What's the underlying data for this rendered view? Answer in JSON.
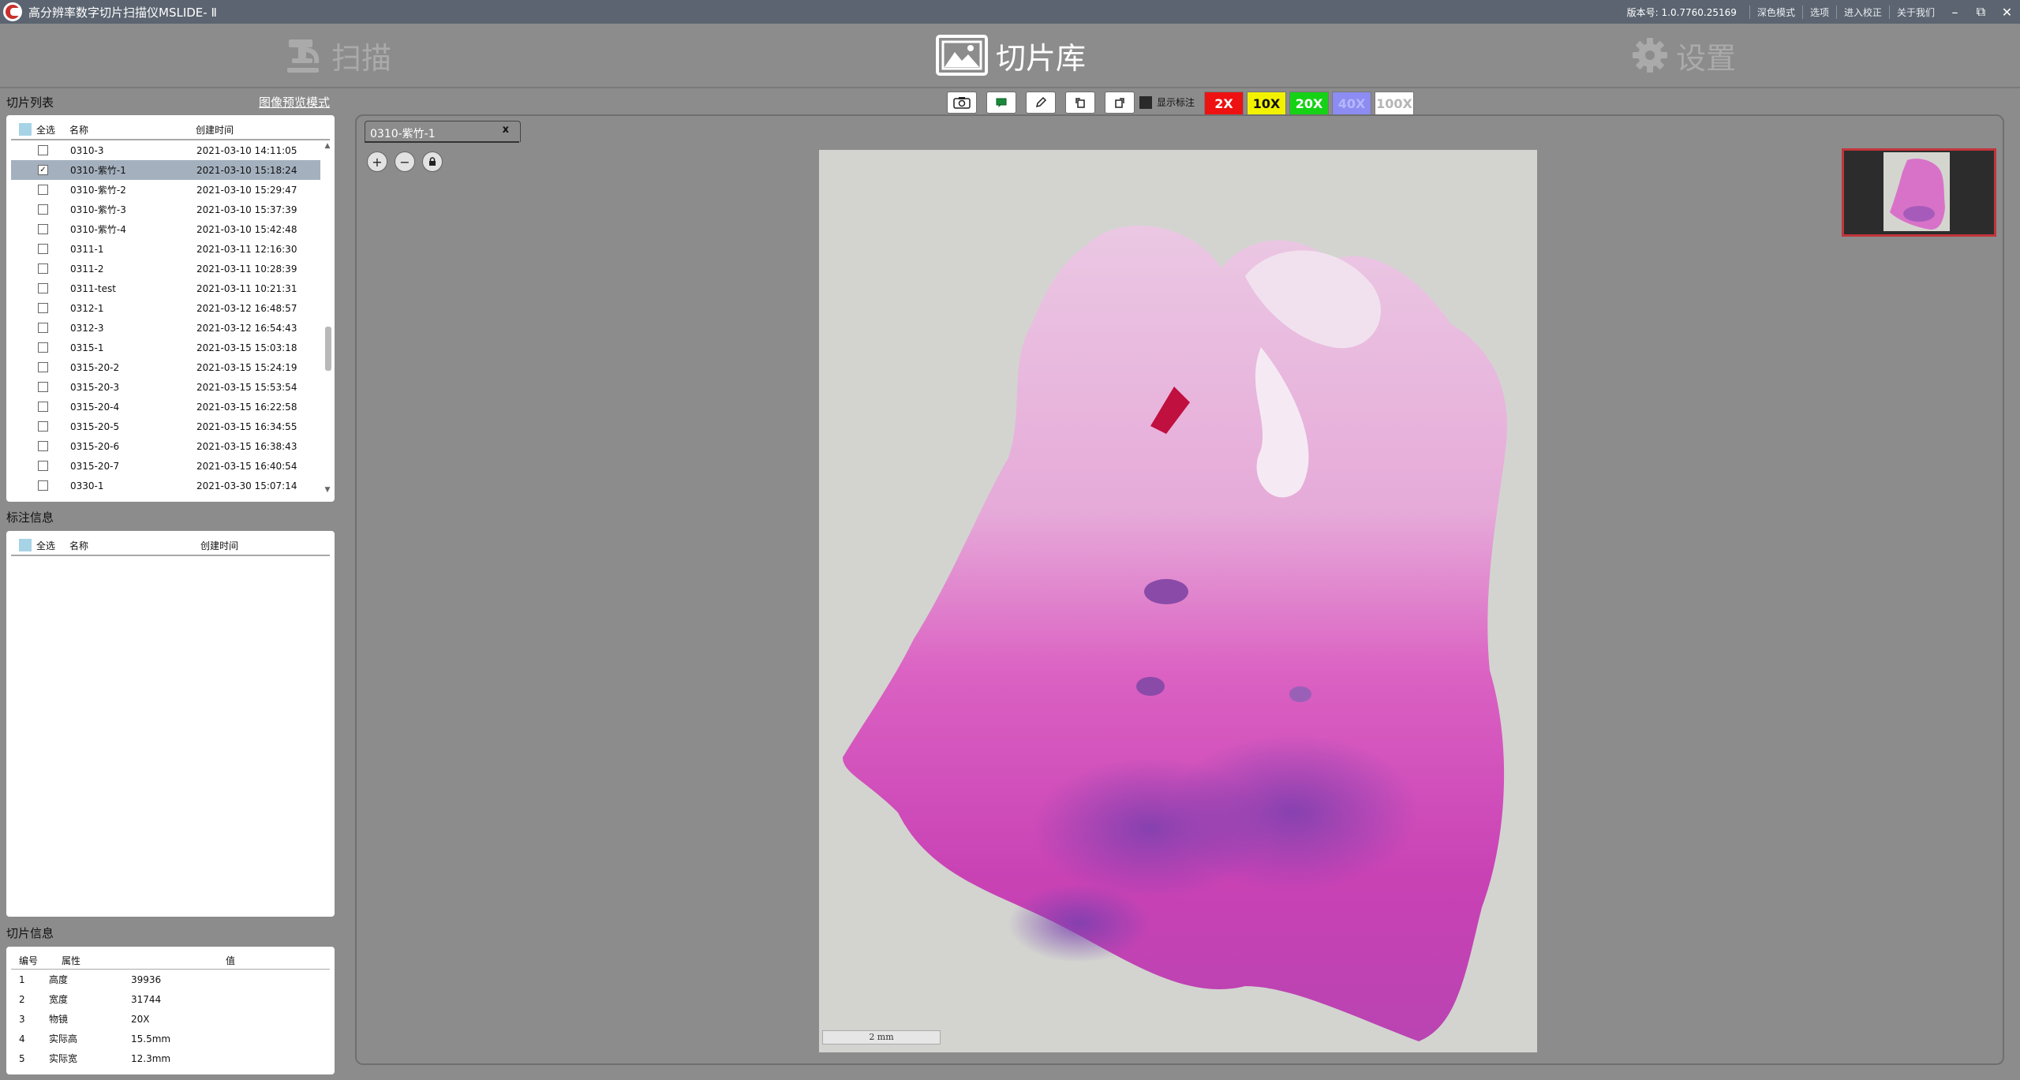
{
  "app": {
    "title": "高分辨率数字切片扫描仪MSLIDE- Ⅱ"
  },
  "titlebar": {
    "version_label": "版本号: 1.0.7760.25169",
    "links": [
      "深色模式",
      "选项",
      "进入校正",
      "关于我们"
    ],
    "window_controls": [
      "minimize-icon",
      "restore-icon",
      "close-icon"
    ]
  },
  "nav": {
    "scan": "扫描",
    "library": "切片库",
    "settings": "设置"
  },
  "slide_list": {
    "title": "切片列表",
    "preview_mode": "图像预览模式",
    "select_all": "全选",
    "col_name": "名称",
    "col_time": "创建时间",
    "rows": [
      {
        "name": "0310-3",
        "time": "2021-03-10 14:11:05",
        "checked": false
      },
      {
        "name": "0310-紫竹-1",
        "time": "2021-03-10 15:18:24",
        "checked": true
      },
      {
        "name": "0310-紫竹-2",
        "time": "2021-03-10 15:29:47",
        "checked": false
      },
      {
        "name": "0310-紫竹-3",
        "time": "2021-03-10 15:37:39",
        "checked": false
      },
      {
        "name": "0310-紫竹-4",
        "time": "2021-03-10 15:42:48",
        "checked": false
      },
      {
        "name": "0311-1",
        "time": "2021-03-11 12:16:30",
        "checked": false
      },
      {
        "name": "0311-2",
        "time": "2021-03-11 10:28:39",
        "checked": false
      },
      {
        "name": "0311-test",
        "time": "2021-03-11 10:21:31",
        "checked": false
      },
      {
        "name": "0312-1",
        "time": "2021-03-12 16:48:57",
        "checked": false
      },
      {
        "name": "0312-3",
        "time": "2021-03-12 16:54:43",
        "checked": false
      },
      {
        "name": "0315-1",
        "time": "2021-03-15 15:03:18",
        "checked": false
      },
      {
        "name": "0315-20-2",
        "time": "2021-03-15 15:24:19",
        "checked": false
      },
      {
        "name": "0315-20-3",
        "time": "2021-03-15 15:53:54",
        "checked": false
      },
      {
        "name": "0315-20-4",
        "time": "2021-03-15 16:22:58",
        "checked": false
      },
      {
        "name": "0315-20-5",
        "time": "2021-03-15 16:34:55",
        "checked": false
      },
      {
        "name": "0315-20-6",
        "time": "2021-03-15 16:38:43",
        "checked": false
      },
      {
        "name": "0315-20-7",
        "time": "2021-03-15 16:40:54",
        "checked": false
      },
      {
        "name": "0330-1",
        "time": "2021-03-30 15:07:14",
        "checked": false
      }
    ]
  },
  "annotation_info": {
    "title": "标注信息",
    "select_all": "全选",
    "col_name": "名称",
    "col_time": "创建时间"
  },
  "slide_info": {
    "title": "切片信息",
    "col_num": "编号",
    "col_prop": "属性",
    "col_val": "值",
    "rows": [
      {
        "num": "1",
        "prop": "高度",
        "val": "39936"
      },
      {
        "num": "2",
        "prop": "宽度",
        "val": "31744"
      },
      {
        "num": "3",
        "prop": "物镜",
        "val": "20X"
      },
      {
        "num": "4",
        "prop": "实际高",
        "val": "15.5mm"
      },
      {
        "num": "5",
        "prop": "实际宽",
        "val": "12.3mm"
      }
    ]
  },
  "toolbar": {
    "tools": [
      "camera-icon",
      "annotation-rect-icon",
      "pencil-icon",
      "rotate-left-icon",
      "rotate-right-icon"
    ],
    "show_annotations": "显示标注",
    "zooms": [
      {
        "label": "2X",
        "bg": "#ee1111",
        "fg": "#ffffff",
        "enabled": true
      },
      {
        "label": "10X",
        "bg": "#f2f200",
        "fg": "#111111",
        "enabled": true
      },
      {
        "label": "20X",
        "bg": "#16d216",
        "fg": "#ffffff",
        "enabled": true
      },
      {
        "label": "40X",
        "bg": "#8c8cf2",
        "fg": "#b6b6ff",
        "enabled": false
      },
      {
        "label": "100X",
        "bg": "#ffffff",
        "fg": "#b5b5b5",
        "enabled": false
      }
    ]
  },
  "viewer": {
    "tab_label": "0310-紫竹-1",
    "tab_close": "x",
    "zoom_in": "+",
    "zoom_out": "−",
    "scalebar": "2 mm"
  },
  "colors": {
    "accent_selected_row": "#a4b0be",
    "thumbnail_border": "#c0353b",
    "titlebar": "#5b6470"
  }
}
